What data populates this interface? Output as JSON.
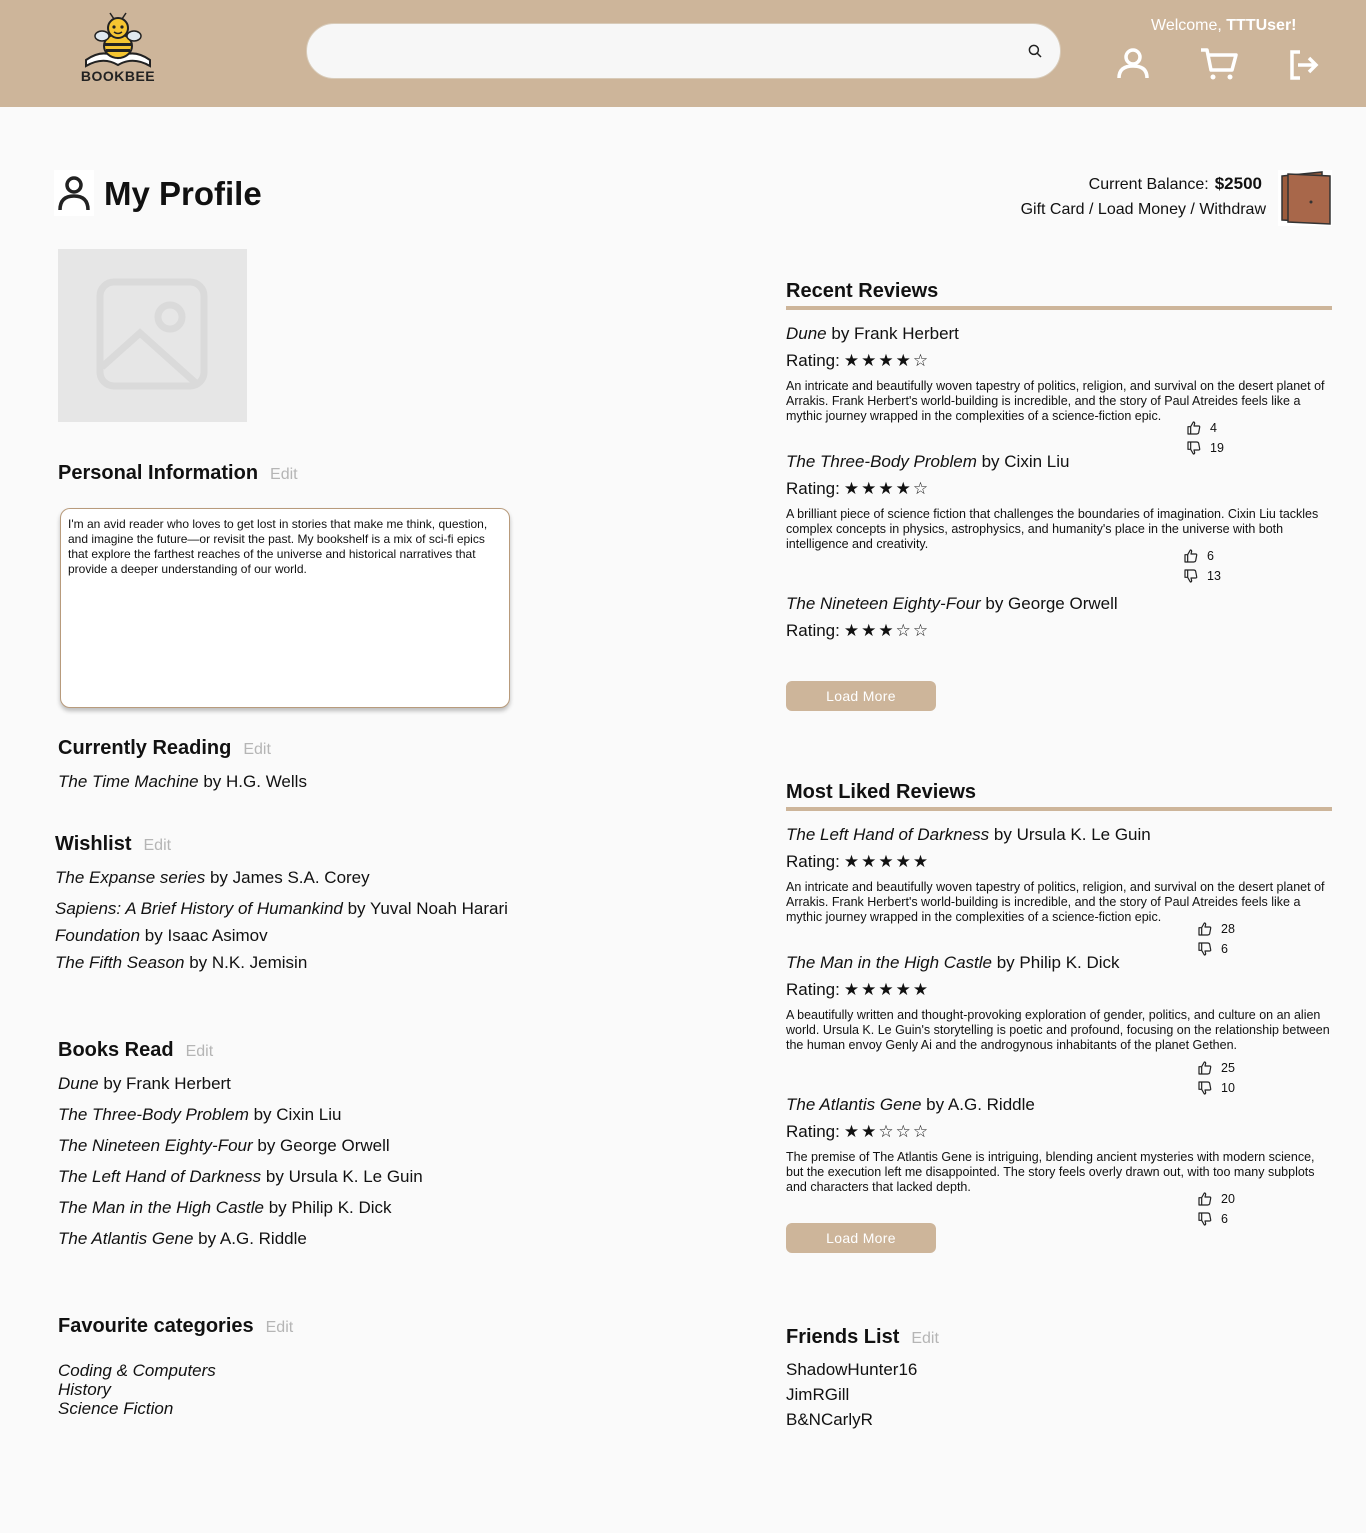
{
  "header": {
    "logo_text": "BOOKBEE",
    "search_placeholder": "",
    "welcome_prefix": "Welcome, ",
    "username": "TTTUser!",
    "icons": [
      "search-icon",
      "user-icon",
      "cart-icon",
      "logout-icon"
    ]
  },
  "profile": {
    "title": "My Profile",
    "balance_label": "Current Balance:",
    "balance_value": "$2500",
    "wallet_actions": "Gift Card / Load Money / Withdraw"
  },
  "personal": {
    "title": "Personal Information",
    "edit": "Edit",
    "bio": "I'm an avid reader who loves to get lost in stories that make me think, question, and imagine the future—or revisit the past. My bookshelf is a mix of sci-fi epics that explore the farthest reaches of the universe and historical narratives that provide a deeper understanding of our world."
  },
  "currently_reading": {
    "title": "Currently Reading",
    "edit": "Edit",
    "items": [
      {
        "book": "The Time Machine",
        "author": " by H.G. Wells"
      }
    ]
  },
  "wishlist": {
    "title": "Wishlist",
    "edit": "Edit",
    "items": [
      {
        "book": "The Expanse series",
        "author": " by James S.A. Corey"
      },
      {
        "book": "Sapiens: A Brief History of Humankind",
        "author": " by Yuval Noah Harari"
      },
      {
        "book": "Foundation",
        "author": " by Isaac Asimov"
      },
      {
        "book": "The Fifth Season",
        "author": " by N.K. Jemisin"
      }
    ]
  },
  "books_read": {
    "title": "Books Read",
    "edit": "Edit",
    "items": [
      {
        "book": "Dune",
        "author": " by Frank Herbert"
      },
      {
        "book": "The Three-Body Problem",
        "author": " by Cixin Liu"
      },
      {
        "book": "The Nineteen Eighty-Four",
        "author": " by George Orwell"
      },
      {
        "book": "The Left Hand of Darkness",
        "author": " by Ursula K. Le Guin"
      },
      {
        "book": "The Man in the High Castle",
        "author": " by Philip K. Dick"
      },
      {
        "book": "The Atlantis Gene",
        "author": " by A.G. Riddle"
      }
    ]
  },
  "categories": {
    "title": "Favourite categories",
    "edit": "Edit",
    "items": [
      "Coding & Computers",
      "History",
      "Science Fiction"
    ]
  },
  "recent_reviews": {
    "title": "Recent Reviews",
    "load_more": "Load More",
    "items": [
      {
        "book": "Dune",
        "author": " by Frank Herbert",
        "rating_label": "Rating:",
        "stars": "★★★★☆",
        "rating": 4,
        "text": "An intricate and beautifully woven tapestry of politics, religion, and survival on the desert planet of Arrakis. Frank Herbert's world-building is incredible, and the story of Paul Atreides feels like a mythic journey wrapped in the complexities of a science-fiction epic.",
        "likes": "4",
        "dislikes": "19"
      },
      {
        "book": "The Three-Body Problem",
        "author": " by Cixin Liu",
        "rating_label": "Rating:",
        "stars": "★★★★☆",
        "rating": 4,
        "text": "A brilliant piece of science fiction that challenges the boundaries of imagination. Cixin Liu tackles complex concepts in physics, astrophysics, and humanity's place in the universe with both intelligence and creativity.",
        "likes": "6",
        "dislikes": "13"
      },
      {
        "book": "The Nineteen Eighty-Four",
        "author": " by George Orwell",
        "rating_label": "Rating:",
        "stars": "★★★☆☆",
        "rating": 3
      }
    ]
  },
  "liked_reviews": {
    "title": "Most Liked Reviews",
    "load_more": "Load More",
    "items": [
      {
        "book": "The Left Hand of Darkness",
        "author": " by Ursula K. Le Guin",
        "rating_label": "Rating:",
        "stars": "★★★★★",
        "rating": 5,
        "text": "An intricate and beautifully woven tapestry of politics, religion, and survival on the desert planet of Arrakis. Frank Herbert's world-building is incredible, and the story of Paul Atreides feels like a mythic journey wrapped in the complexities of a science-fiction epic.",
        "likes": "28",
        "dislikes": "6"
      },
      {
        "book": "The Man in the High Castle",
        "author": " by Philip K. Dick",
        "rating_label": "Rating:",
        "stars": "★★★★★",
        "rating": 5,
        "text": "A beautifully written and thought-provoking exploration of gender, politics, and culture on an alien world. Ursula K. Le Guin's storytelling is poetic and profound, focusing on the relationship between the human envoy Genly Ai and the androgynous inhabitants of the planet Gethen.",
        "likes": "25",
        "dislikes": "10"
      },
      {
        "book": "The Atlantis Gene",
        "author": " by A.G. Riddle",
        "rating_label": "Rating:",
        "stars": "★★☆☆☆",
        "rating": 2,
        "text": "The premise of The Atlantis Gene is intriguing, blending ancient mysteries with modern science, but the execution left me disappointed. The story feels overly drawn out, with too many subplots and characters that lacked depth.",
        "likes": "20",
        "dislikes": "6"
      }
    ]
  },
  "friends": {
    "title": "Friends List",
    "edit": "Edit",
    "items": [
      "ShadowHunter16",
      "JimRGill",
      "B&NCarlyR"
    ]
  },
  "colors": {
    "accent": "#cdb59a",
    "background": "#fafafa",
    "wallet": "#9c5c3c"
  }
}
